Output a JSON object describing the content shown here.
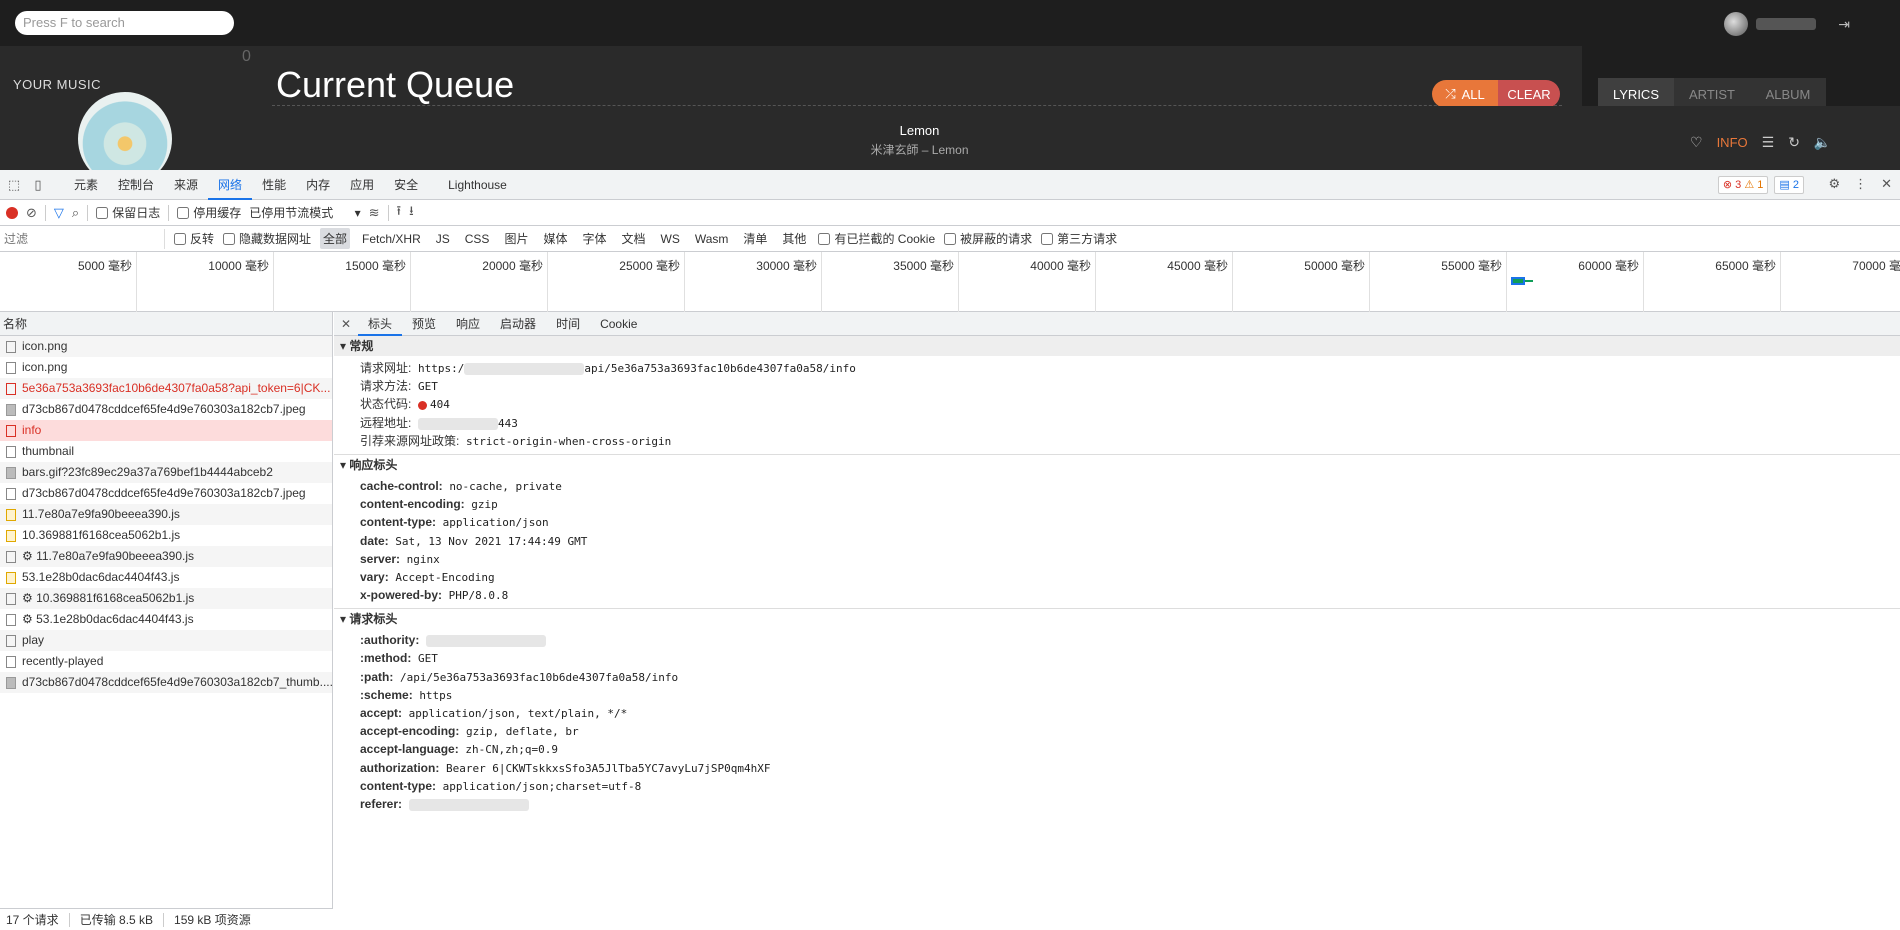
{
  "app": {
    "search_placeholder": "Press F to search",
    "your_music": "YOUR MUSIC",
    "queue_count": "0",
    "queue_title": "Current Queue",
    "btn_all": "ALL",
    "btn_clear": "CLEAR",
    "tabs": [
      "LYRICS",
      "ARTIST",
      "ALBUM"
    ],
    "song_title": "Lemon",
    "song_artist": "米津玄師 – Lemon",
    "info_label": "INFO"
  },
  "devtools": {
    "tabs": [
      "元素",
      "控制台",
      "来源",
      "网络",
      "性能",
      "内存",
      "应用",
      "安全",
      "Lighthouse"
    ],
    "active_tab": "网络",
    "badges": {
      "errors": "3",
      "warnings": "1",
      "messages": "2"
    },
    "toolbar": {
      "preserve_log": "保留日志",
      "disable_cache": "停用缓存",
      "throttle": "已停用节流模式"
    },
    "filter": {
      "placeholder": "过滤",
      "invert": "反转",
      "hide_data_urls": "隐藏数据网址",
      "types": [
        "全部",
        "Fetch/XHR",
        "JS",
        "CSS",
        "图片",
        "媒体",
        "字体",
        "文档",
        "WS",
        "Wasm",
        "清单",
        "其他"
      ],
      "blocked_cookies": "有已拦截的 Cookie",
      "blocked_requests": "被屏蔽的请求",
      "third_party": "第三方请求"
    },
    "timeline_ticks": [
      "5000 毫秒",
      "10000 毫秒",
      "15000 毫秒",
      "20000 毫秒",
      "25000 毫秒",
      "30000 毫秒",
      "35000 毫秒",
      "40000 毫秒",
      "45000 毫秒",
      "50000 毫秒",
      "55000 毫秒",
      "60000 毫秒",
      "65000 毫秒",
      "70000 毫秒"
    ],
    "list_header": "名称",
    "requests": [
      {
        "name": "icon.png",
        "kind": "file"
      },
      {
        "name": "icon.png",
        "kind": "file"
      },
      {
        "name": "5e36a753a3693fac10b6de4307fa0a58?api_token=6|CK...",
        "kind": "err"
      },
      {
        "name": "d73cb867d0478cddcef65fe4d9e760303a182cb7.jpeg",
        "kind": "img"
      },
      {
        "name": "info",
        "kind": "sel"
      },
      {
        "name": "thumbnail",
        "kind": "file"
      },
      {
        "name": "bars.gif?23fc89ec29a37a769bef1b4444abceb2",
        "kind": "img"
      },
      {
        "name": "d73cb867d0478cddcef65fe4d9e760303a182cb7.jpeg",
        "kind": "file"
      },
      {
        "name": "11.7e80a7e9fa90beeea390.js",
        "kind": "js"
      },
      {
        "name": "10.369881f6168cea5062b1.js",
        "kind": "js"
      },
      {
        "name": "⚙ 11.7e80a7e9fa90beeea390.js",
        "kind": "file"
      },
      {
        "name": "53.1e28b0dac6dac4404f43.js",
        "kind": "js"
      },
      {
        "name": "⚙ 10.369881f6168cea5062b1.js",
        "kind": "file"
      },
      {
        "name": "⚙ 53.1e28b0dac6dac4404f43.js",
        "kind": "file"
      },
      {
        "name": "play",
        "kind": "file"
      },
      {
        "name": "recently-played",
        "kind": "file"
      },
      {
        "name": "d73cb867d0478cddcef65fe4d9e760303a182cb7_thumb....",
        "kind": "img"
      }
    ],
    "footer": {
      "requests": "17 个请求",
      "transferred": "已传输 8.5 kB",
      "resources": "159 kB 项资源"
    },
    "detail_tabs": [
      "标头",
      "预览",
      "响应",
      "启动器",
      "时间",
      "Cookie"
    ],
    "general": {
      "title": "常规",
      "url_label": "请求网址:",
      "url_prefix": "https:/",
      "url_suffix": "api/5e36a753a3693fac10b6de4307fa0a58/info",
      "method_label": "请求方法:",
      "method": "GET",
      "status_label": "状态代码:",
      "status": "404",
      "remote_label": "远程地址:",
      "remote_port": "443",
      "referrer_label": "引荐来源网址政策:",
      "referrer": "strict-origin-when-cross-origin"
    },
    "response_headers": {
      "title": "响应标头",
      "items": [
        {
          "k": "cache-control:",
          "v": "no-cache, private"
        },
        {
          "k": "content-encoding:",
          "v": "gzip"
        },
        {
          "k": "content-type:",
          "v": "application/json"
        },
        {
          "k": "date:",
          "v": "Sat, 13 Nov 2021 17:44:49 GMT"
        },
        {
          "k": "server:",
          "v": "nginx"
        },
        {
          "k": "vary:",
          "v": "Accept-Encoding"
        },
        {
          "k": "x-powered-by:",
          "v": "PHP/8.0.8"
        }
      ]
    },
    "request_headers": {
      "title": "请求标头",
      "items": [
        {
          "k": ":authority:",
          "v": ""
        },
        {
          "k": ":method:",
          "v": "GET"
        },
        {
          "k": ":path:",
          "v": "/api/5e36a753a3693fac10b6de4307fa0a58/info"
        },
        {
          "k": ":scheme:",
          "v": "https"
        },
        {
          "k": "accept:",
          "v": "application/json, text/plain, */*"
        },
        {
          "k": "accept-encoding:",
          "v": "gzip, deflate, br"
        },
        {
          "k": "accept-language:",
          "v": "zh-CN,zh;q=0.9"
        },
        {
          "k": "authorization:",
          "v": "Bearer 6|CKWTskkxsSfo3A5JlTba5YC7avyLu7jSP0qm4hXF"
        },
        {
          "k": "content-type:",
          "v": "application/json;charset=utf-8"
        },
        {
          "k": "referer:",
          "v": ""
        }
      ]
    }
  }
}
